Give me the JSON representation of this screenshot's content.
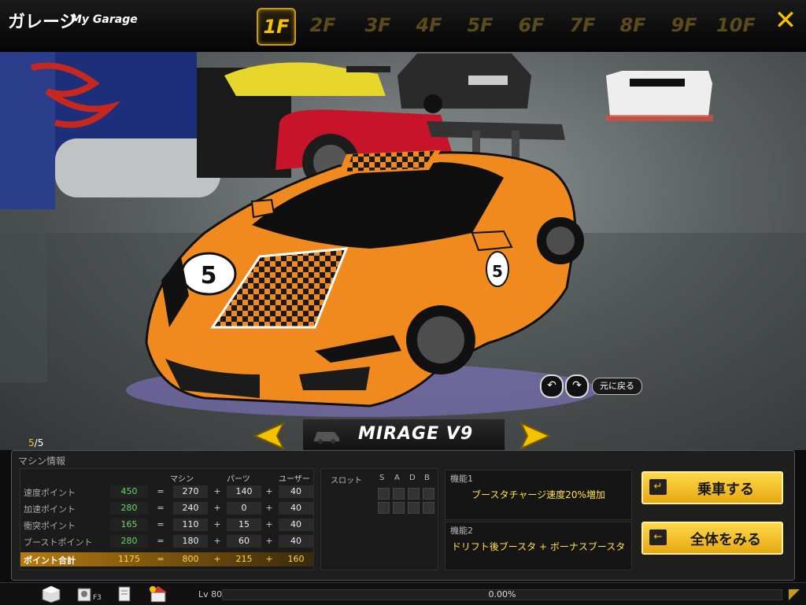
{
  "header": {
    "title_jp": "ガレージ",
    "title_en": "My Garage",
    "floors": [
      "1F",
      "2F",
      "3F",
      "4F",
      "5F",
      "6F",
      "7F",
      "8F",
      "9F",
      "10F"
    ],
    "active_floor": "1F",
    "close_icon": "close-x-icon"
  },
  "viewer": {
    "rotate_left_icon": "rotate-left-icon",
    "rotate_right_icon": "rotate-right-icon",
    "reset_label": "元に戻る"
  },
  "selector": {
    "current": "5",
    "total": "5",
    "car_name": "MIRAGE V9"
  },
  "machine_info": {
    "title": "マシン情報",
    "columns": [
      "マシン",
      "パーツ",
      "ユーザー"
    ],
    "rows": [
      {
        "label": "速度ポイント",
        "total": "450",
        "machine": "270",
        "parts": "140",
        "user": "40"
      },
      {
        "label": "加速ポイント",
        "total": "280",
        "machine": "240",
        "parts": "0",
        "user": "40"
      },
      {
        "label": "衝突ポイント",
        "total": "165",
        "machine": "110",
        "parts": "15",
        "user": "40"
      },
      {
        "label": "ブーストポイント",
        "total": "280",
        "machine": "180",
        "parts": "60",
        "user": "40"
      }
    ],
    "sum_row": {
      "label": "ポイント合計",
      "total": "1175",
      "machine": "800",
      "parts": "215",
      "user": "160"
    },
    "ops": {
      "eq": "=",
      "plus": "+"
    }
  },
  "slots": {
    "label": "スロット",
    "headers": [
      "S",
      "A",
      "D",
      "B"
    ]
  },
  "functions": {
    "f1_label": "機能1",
    "f1_value": "ブースタチャージ速度20%増加",
    "f2_label": "機能2",
    "f2_value": "ドリフト後ブースタ + ボーナスブースタ"
  },
  "actions": {
    "ride_label": "乗車する",
    "view_all_label": "全体をみる"
  },
  "bottom": {
    "f3_label": "F3",
    "level": "Lv 80",
    "exp_percent": "0.00%"
  },
  "colors": {
    "accent": "#f5c200",
    "car_body": "#f08a1e",
    "stat_total": "#69d36e"
  }
}
